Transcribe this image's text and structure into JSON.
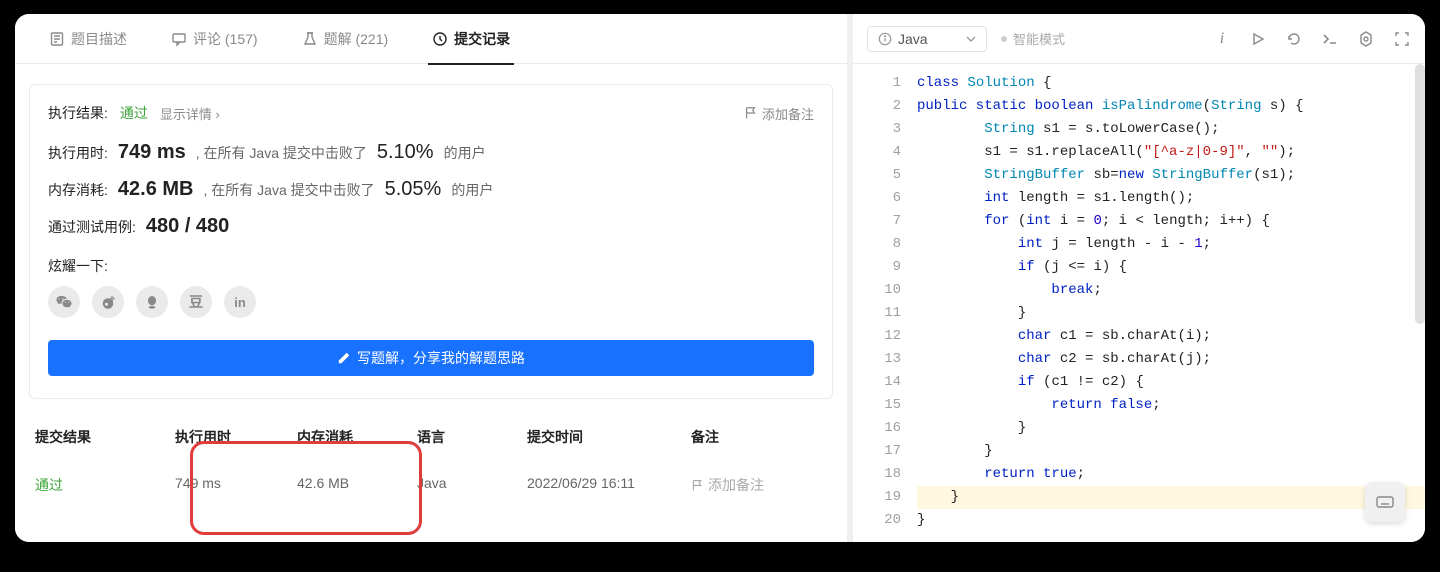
{
  "tabs": {
    "description": "题目描述",
    "comments": "评论 (157)",
    "solutions": "题解 (221)",
    "submissions": "提交记录"
  },
  "result": {
    "label": "执行结果:",
    "status": "通过",
    "detail_link": "显示详情 ›",
    "add_note": "添加备注",
    "runtime_label": "执行用时:",
    "runtime_value": "749 ms",
    "runtime_text1": ", 在所有 Java 提交中击败了",
    "runtime_pct": "5.10%",
    "runtime_text2": "的用户",
    "memory_label": "内存消耗:",
    "memory_value": "42.6 MB",
    "memory_text1": ", 在所有 Java 提交中击败了",
    "memory_pct": "5.05%",
    "memory_text2": "的用户",
    "testcase_label": "通过测试用例:",
    "testcase_value": "480 / 480",
    "brag": "炫耀一下:",
    "write_btn": "写题解，分享我的解题思路"
  },
  "table": {
    "headers": {
      "c1": "提交结果",
      "c2": "执行用时",
      "c3": "内存消耗",
      "c4": "语言",
      "c5": "提交时间",
      "c6": "备注"
    },
    "row": {
      "c1": "通过",
      "c2": "749 ms",
      "c3": "42.6 MB",
      "c4": "Java",
      "c5": "2022/06/29 16:11",
      "c6": "添加备注"
    }
  },
  "right": {
    "language": "Java",
    "mode": "智能模式"
  },
  "code": [
    {
      "n": 1,
      "hl": false,
      "spans": [
        {
          "t": "class ",
          "c": "kw-blue"
        },
        {
          "t": "Solution",
          "c": "kw-teal"
        },
        {
          "t": " {",
          "c": "txt"
        }
      ]
    },
    {
      "n": 2,
      "hl": false,
      "spans": [
        {
          "t": "public static boolean ",
          "c": "kw-blue"
        },
        {
          "t": "isPalindrome",
          "c": "kw-teal"
        },
        {
          "t": "(",
          "c": "txt"
        },
        {
          "t": "String",
          "c": "kw-teal"
        },
        {
          "t": " s) {",
          "c": "txt"
        }
      ]
    },
    {
      "n": 3,
      "hl": false,
      "spans": [
        {
          "t": "        ",
          "c": "txt"
        },
        {
          "t": "String",
          "c": "kw-teal"
        },
        {
          "t": " s1 = s.toLowerCase();",
          "c": "txt"
        }
      ]
    },
    {
      "n": 4,
      "hl": false,
      "spans": [
        {
          "t": "        s1 = s1.replaceAll(",
          "c": "txt"
        },
        {
          "t": "\"[^a-z|0-9]\"",
          "c": "str-red"
        },
        {
          "t": ", ",
          "c": "txt"
        },
        {
          "t": "\"\"",
          "c": "str-red"
        },
        {
          "t": ");",
          "c": "txt"
        }
      ]
    },
    {
      "n": 5,
      "hl": false,
      "spans": [
        {
          "t": "        ",
          "c": "txt"
        },
        {
          "t": "StringBuffer",
          "c": "kw-teal"
        },
        {
          "t": " sb=",
          "c": "txt"
        },
        {
          "t": "new ",
          "c": "kw-blue"
        },
        {
          "t": "StringBuffer",
          "c": "kw-teal"
        },
        {
          "t": "(s1);",
          "c": "txt"
        }
      ]
    },
    {
      "n": 6,
      "hl": false,
      "spans": [
        {
          "t": "        ",
          "c": "txt"
        },
        {
          "t": "int ",
          "c": "kw-blue"
        },
        {
          "t": "length = s1.length();",
          "c": "txt"
        }
      ]
    },
    {
      "n": 7,
      "hl": false,
      "spans": [
        {
          "t": "        ",
          "c": "txt"
        },
        {
          "t": "for ",
          "c": "kw-blue"
        },
        {
          "t": "(",
          "c": "txt"
        },
        {
          "t": "int ",
          "c": "kw-blue"
        },
        {
          "t": "i = ",
          "c": "txt"
        },
        {
          "t": "0",
          "c": "lit-blue"
        },
        {
          "t": "; i < length; i++) {",
          "c": "txt"
        }
      ]
    },
    {
      "n": 8,
      "hl": false,
      "spans": [
        {
          "t": "            ",
          "c": "txt"
        },
        {
          "t": "int ",
          "c": "kw-blue"
        },
        {
          "t": "j = length - i - ",
          "c": "txt"
        },
        {
          "t": "1",
          "c": "lit-blue"
        },
        {
          "t": ";",
          "c": "txt"
        }
      ]
    },
    {
      "n": 9,
      "hl": false,
      "spans": [
        {
          "t": "            ",
          "c": "txt"
        },
        {
          "t": "if ",
          "c": "kw-blue"
        },
        {
          "t": "(j <= i) {",
          "c": "txt"
        }
      ]
    },
    {
      "n": 10,
      "hl": false,
      "spans": [
        {
          "t": "                ",
          "c": "txt"
        },
        {
          "t": "break",
          "c": "kw-blue"
        },
        {
          "t": ";",
          "c": "txt"
        }
      ]
    },
    {
      "n": 11,
      "hl": false,
      "spans": [
        {
          "t": "            }",
          "c": "txt"
        }
      ]
    },
    {
      "n": 12,
      "hl": false,
      "spans": [
        {
          "t": "            ",
          "c": "txt"
        },
        {
          "t": "char ",
          "c": "kw-blue"
        },
        {
          "t": "c1 = sb.charAt(i);",
          "c": "txt"
        }
      ]
    },
    {
      "n": 13,
      "hl": false,
      "spans": [
        {
          "t": "            ",
          "c": "txt"
        },
        {
          "t": "char ",
          "c": "kw-blue"
        },
        {
          "t": "c2 = sb.charAt(j);",
          "c": "txt"
        }
      ]
    },
    {
      "n": 14,
      "hl": false,
      "spans": [
        {
          "t": "            ",
          "c": "txt"
        },
        {
          "t": "if ",
          "c": "kw-blue"
        },
        {
          "t": "(c1 != c2) {",
          "c": "txt"
        }
      ]
    },
    {
      "n": 15,
      "hl": false,
      "spans": [
        {
          "t": "                ",
          "c": "txt"
        },
        {
          "t": "return false",
          "c": "kw-blue"
        },
        {
          "t": ";",
          "c": "txt"
        }
      ]
    },
    {
      "n": 16,
      "hl": false,
      "spans": [
        {
          "t": "            }",
          "c": "txt"
        }
      ]
    },
    {
      "n": 17,
      "hl": false,
      "spans": [
        {
          "t": "        }",
          "c": "txt"
        }
      ]
    },
    {
      "n": 18,
      "hl": false,
      "spans": [
        {
          "t": "        ",
          "c": "txt"
        },
        {
          "t": "return true",
          "c": "kw-blue"
        },
        {
          "t": ";",
          "c": "txt"
        }
      ]
    },
    {
      "n": 19,
      "hl": true,
      "spans": [
        {
          "t": "    }",
          "c": "txt"
        }
      ]
    },
    {
      "n": 20,
      "hl": false,
      "spans": [
        {
          "t": "}",
          "c": "txt"
        }
      ]
    }
  ]
}
